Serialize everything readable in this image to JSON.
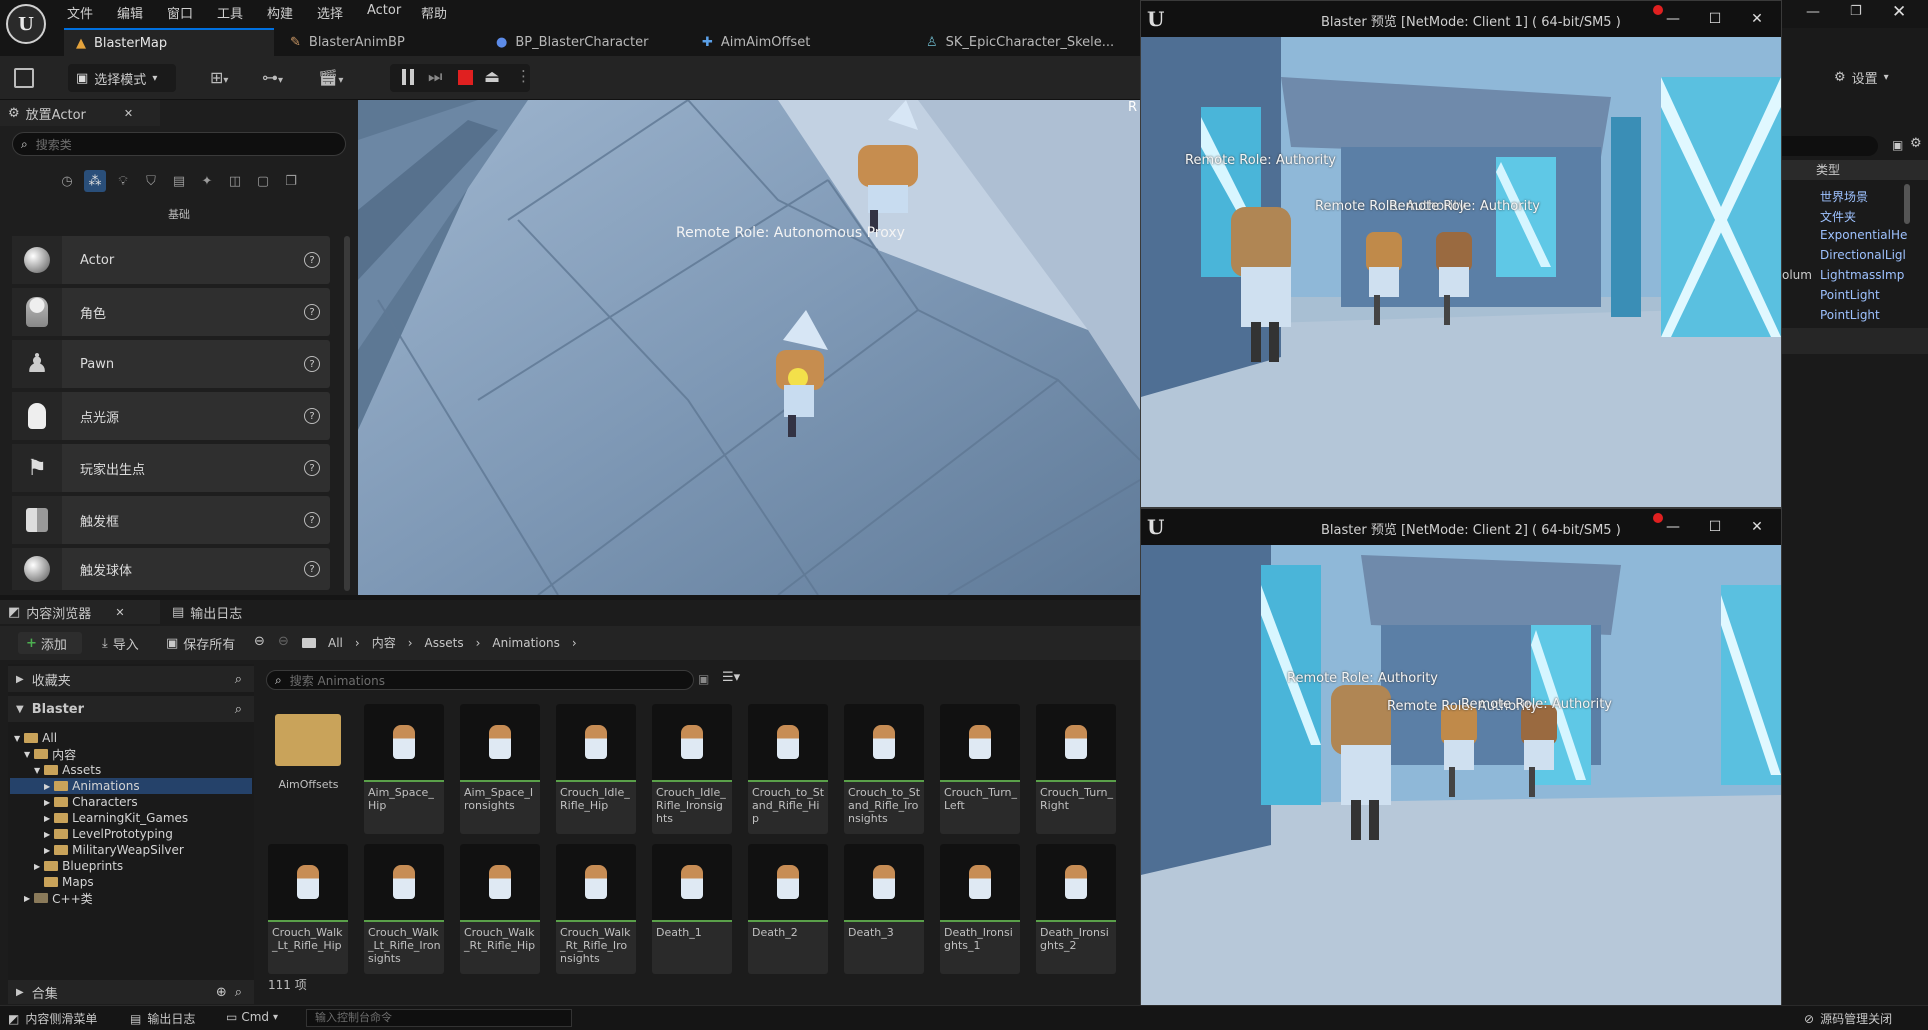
{
  "menus": [
    "文件",
    "编辑",
    "窗口",
    "工具",
    "构建",
    "选择",
    "Actor",
    "帮助"
  ],
  "tabs": [
    "BlasterMap",
    "BlasterAnimBP",
    "BP_BlasterCharacter",
    "AimAimOffset",
    "SK_EpicCharacter_Skele..."
  ],
  "toolbar": {
    "mode_label": "选择模式",
    "settings_label": "设置"
  },
  "place_actors": {
    "tab_label": "放置Actor",
    "search_placeholder": "搜索类",
    "category_label": "基础",
    "items": [
      "Actor",
      "角色",
      "Pawn",
      "点光源",
      "玩家出生点",
      "触发框",
      "触发球体"
    ]
  },
  "viewport": {
    "overlay_text": "Remote Role: Autonomous Proxy",
    "corner_text": "R"
  },
  "content_browser": {
    "tab_label": "内容浏览器",
    "log_tab_label": "输出日志",
    "add_label": "添加",
    "import_label": "导入",
    "save_all_label": "保存所有",
    "breadcrumb": [
      "All",
      "内容",
      "Assets",
      "Animations"
    ],
    "favorites_label": "收藏夹",
    "root_label": "Blaster",
    "tree": [
      {
        "label": "All",
        "level": 0
      },
      {
        "label": "内容",
        "level": 1
      },
      {
        "label": "Assets",
        "level": 2
      },
      {
        "label": "Animations",
        "level": 3,
        "selected": true
      },
      {
        "label": "Characters",
        "level": 3
      },
      {
        "label": "LearningKit_Games",
        "level": 3
      },
      {
        "label": "LevelPrototyping",
        "level": 3
      },
      {
        "label": "MilitaryWeapSilver",
        "level": 3
      },
      {
        "label": "Blueprints",
        "level": 2
      },
      {
        "label": "Maps",
        "level": 2
      },
      {
        "label": "C++类",
        "level": 0
      }
    ],
    "collections_label": "合集",
    "search_placeholder": "搜索 Animations",
    "assets_row1": [
      "AimOffsets",
      "Aim_Space_Hip",
      "Aim_Space_Ironsights",
      "Crouch_Idle_Rifle_Hip",
      "Crouch_Idle_Rifle_Ironsights",
      "Crouch_to_Stand_Rifle_Hip",
      "Crouch_to_Stand_Rifle_Ironsights",
      "Crouch_Turn_Left",
      "Crouch_Turn_Right"
    ],
    "assets_row2": [
      "Crouch_Walk_Lt_Rifle_Hip",
      "Crouch_Walk_Lt_Rifle_Ironsights",
      "Crouch_Walk_Rt_Rifle_Hip",
      "Crouch_Walk_Rt_Rifle_Ironsights",
      "Death_1",
      "Death_2",
      "Death_3",
      "Death_Ironsights_1",
      "Death_Ironsights_2"
    ],
    "item_count": "111 项"
  },
  "client1": {
    "title": "Blaster 预览 [NetMode: Client 1]  ( 64-bit/SM5 )",
    "role_main": "Remote Role: Authority",
    "role_a": "Remote Role: Authority",
    "role_b": "Remote Role: Authority"
  },
  "client2": {
    "title": "Blaster 预览 [NetMode: Client 2]  ( 64-bit/SM5 )",
    "role_main": "Remote Role: Authority",
    "role_a": "Remote Role: Authority",
    "role_b": "Remote Role: Authority"
  },
  "outliner": {
    "type_header": "类型",
    "types": [
      "世界场景",
      "文件夹",
      "ExponentialHe",
      "DirectionalLigl",
      "LightmassImp",
      "PointLight",
      "PointLight"
    ],
    "partial_label": "olum"
  },
  "status": {
    "drawer_label": "内容侧滑菜单",
    "log_label": "输出日志",
    "cmd_label": "Cmd",
    "console_placeholder": "输入控制台命令",
    "source_control_label": "源码管理关闭"
  },
  "colors": {
    "accent": "#0070e0",
    "folder": "#c9a35a",
    "anim_underline": "#5aa04a",
    "record": "#e02020"
  }
}
